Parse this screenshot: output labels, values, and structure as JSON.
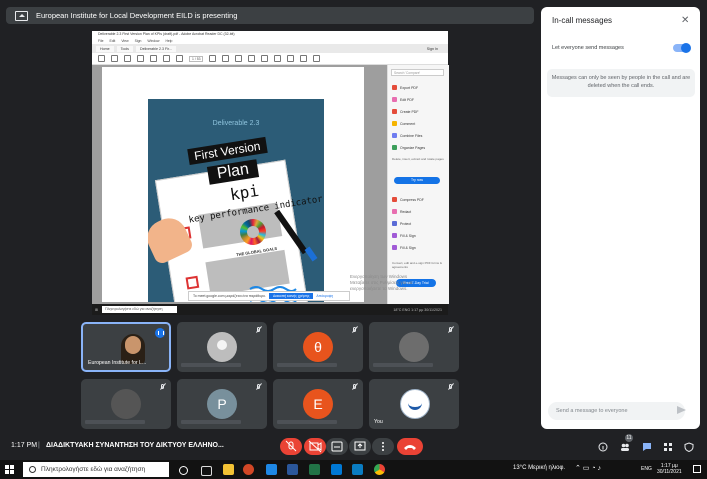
{
  "banner": {
    "text": "European Institute for Local Development EILD is presenting"
  },
  "acrobat": {
    "window_title": "Deliverable 2.3 First Version Plan of KPIs (draft).pdf - Adobe Acrobat Reader DC (32-bit)",
    "menu": [
      "File",
      "Edit",
      "View",
      "Sign",
      "Window",
      "Help"
    ],
    "tabs": [
      "Home",
      "Tools",
      "Deliverable 2.3 Fir..."
    ],
    "sign_in": "Sign In",
    "toolbar_field": "1 / 53",
    "search_placeholder": "Search 'Compare'",
    "tools": [
      {
        "label": "Export PDF",
        "color": "#e44c3a"
      },
      {
        "label": "Edit PDF",
        "color": "#e86eb0"
      },
      {
        "label": "Create PDF",
        "color": "#e44c3a"
      },
      {
        "label": "Comment",
        "color": "#f5b400"
      },
      {
        "label": "Combine Files",
        "color": "#6e7cf0"
      },
      {
        "label": "Organize Pages",
        "color": "#3c9e5a"
      }
    ],
    "tools_desc": "Delete, insert, extract and rotate pages",
    "try_now": "Try now",
    "tools2": [
      {
        "label": "Compress PDF",
        "color": "#e44c3a"
      },
      {
        "label": "Redact",
        "color": "#e86eb0"
      },
      {
        "label": "Protect",
        "color": "#5a6bd6"
      },
      {
        "label": "Fill & Sign",
        "color": "#a05ad6"
      },
      {
        "label": "Fill & Sign",
        "color": "#a05ad6"
      }
    ],
    "promo": "Convert, edit and e-sign PDF forms & agreements",
    "free_trial": "Free 7-Day Trial"
  },
  "document": {
    "deliverable": "Deliverable 2.3",
    "first_version": "First Version",
    "plan": "Plan",
    "kpi": "kpi",
    "kpi_full": "key performance indicator",
    "sdg_label": "THE GLOBAL GOALS"
  },
  "watermark": {
    "line1": "Ενεργοποίηση των Windows",
    "line2": "Μεταβείτε στις Ρυθμίσεις για να",
    "line3": "ενεργοποιήσετε τα Windows."
  },
  "share_notice": {
    "text": "Το meet.google.com μοιράζεται ένα παράθυρο.",
    "stop": "Διακοπή κοινής χρήσης",
    "hide": "Απόκρυψη"
  },
  "inner_taskbar": {
    "search": "Πληκτρολογήστε εδώ για αναζήτηση",
    "tray": "18°C  ENG  1:17 μμ  30/11/2021"
  },
  "tiles": [
    {
      "name": "European Institute for L...",
      "type": "video"
    },
    {
      "name": "",
      "type": "gray-avatar"
    },
    {
      "name": "",
      "letter": "θ",
      "avatar_color": "#e8541d"
    },
    {
      "name": "",
      "type": "photo"
    },
    {
      "name": "",
      "type": "photo-dark"
    },
    {
      "name": "",
      "letter": "P",
      "avatar_color": "#78909c"
    },
    {
      "name": "",
      "letter": "E",
      "avatar_color": "#e8541d"
    },
    {
      "name": "You",
      "type": "logo"
    }
  ],
  "panel": {
    "title": "In-call messages",
    "toggle_label": "Let everyone send messages",
    "info": "Messages can only be seen by people in the call and are deleted when the call ends.",
    "send_placeholder": "Send a message to everyone",
    "people_count": "11"
  },
  "bottom": {
    "time": "1:17 PM",
    "meeting": "ΔΙΑΔΙΚΤΥΑΚΗ ΣΥΝΑΝΤΗΣΗ ΤΟΥ ΔΙΚΤΥΟΥ ΕΛΛΗΝΟ..."
  },
  "taskbar": {
    "search": "Πληκτρολογήστε εδώ για αναζήτηση",
    "weather": "13°C  Μερική ηλιοφ.",
    "lang": "ENG",
    "time": "1:17 μμ",
    "date": "30/11/2021"
  }
}
